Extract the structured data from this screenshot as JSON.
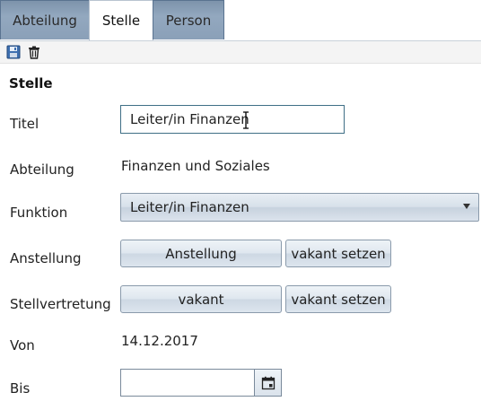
{
  "tabs": [
    {
      "label": "Abteilung",
      "active": false
    },
    {
      "label": "Stelle",
      "active": true
    },
    {
      "label": "Person",
      "active": false
    }
  ],
  "toolbar": {
    "save_icon": "save-icon",
    "delete_icon": "trash-icon"
  },
  "form": {
    "section_title": "Stelle",
    "titel": {
      "label": "Titel",
      "value": "Leiter/in Finanzen"
    },
    "abteilung": {
      "label": "Abteilung",
      "value": "Finanzen und Soziales"
    },
    "funktion": {
      "label": "Funktion",
      "selected": "Leiter/in Finanzen"
    },
    "anstellung": {
      "label": "Anstellung",
      "button": "Anstellung",
      "vakant_button": "vakant setzen"
    },
    "stellvertretung": {
      "label": "Stellvertretung",
      "button": "vakant",
      "vakant_button": "vakant setzen"
    },
    "von": {
      "label": "Von",
      "value": "14.12.2017"
    },
    "bis": {
      "label": "Bis",
      "value": "",
      "calendar_icon": "calendar-icon"
    }
  }
}
